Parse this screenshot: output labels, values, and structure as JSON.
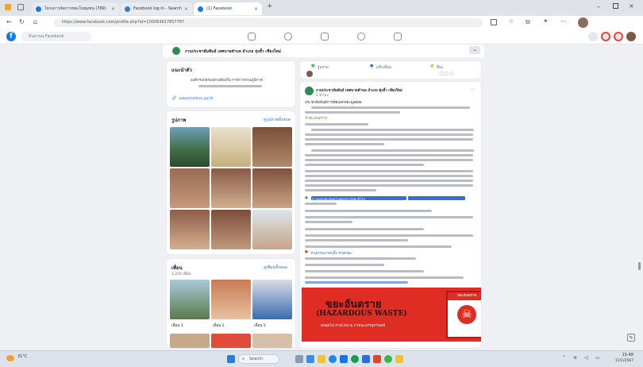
{
  "browser": {
    "tabs": [
      {
        "label": "โครงการจัดการขยะในชุมชน (789)"
      },
      {
        "label": "Facebook log in - Search"
      },
      {
        "label": "(1) Facebook"
      }
    ],
    "url": "https://www.facebook.com/profile.php?id=100064917857787"
  },
  "fb": {
    "search_placeholder": "ค้นหาบน Facebook"
  },
  "page": {
    "name": "งานประชาสัมพันธ์ เทศบาลตำบล อำเภอ ทุ่งฮั้ว เชียงใหม่"
  },
  "intro": {
    "title": "แนะนำตัว",
    "text": "องค์กรปกครองส่วนท้องถิ่น ราชการส่วนภูมิภาค",
    "site": "www.tambon.go.th"
  },
  "photos": {
    "title": "รูปภาพ",
    "see_all": "ดูรูปภาพทั้งหมด"
  },
  "friends": {
    "title": "เพื่อน",
    "count": "1,235 เพื่อน",
    "see_all": "ดูเพื่อนทั้งหมด",
    "items": [
      {
        "name": "เพื่อน 1"
      },
      {
        "name": "เพื่อน 2"
      },
      {
        "name": "เพื่อน 3"
      }
    ]
  },
  "composer": {
    "actions": [
      "รูปภาพ",
      "แท็กเพื่อน",
      "อื่นๆ"
    ]
  },
  "post": {
    "author": "งานประชาสัมพันธ์ เทศบาลตำบล อำเภอ ทุ่งฮั้ว เชียงใหม่",
    "time": "1 ชั่วโมง",
    "line1": "ประชาสัมพันธ์การคัดแยกขยะมูลฝอย",
    "hashtag": "#ขยะอันตราย",
    "link1": "#แยกขยะก่อนทิ้ง #ลดขยะ",
    "highlight": "การแยกขยะอันตรายออกจากขยะทั่วไป"
  },
  "banner": {
    "title_th": "ขยะอันตราย",
    "title_en": "(HAZARDOUS WASTE)",
    "sub": "หลอดไฟ ถ่านไฟฉาย ภาชนะบรรจุสารเคมี",
    "tag": "ขยะอันตราย"
  },
  "taskbar": {
    "search_label": "Search",
    "weather": "31°C",
    "time": "15:48",
    "date": "11/1/2567"
  },
  "colors": {
    "fb_blue": "#1877f2",
    "banner_red": "#e02d24"
  }
}
